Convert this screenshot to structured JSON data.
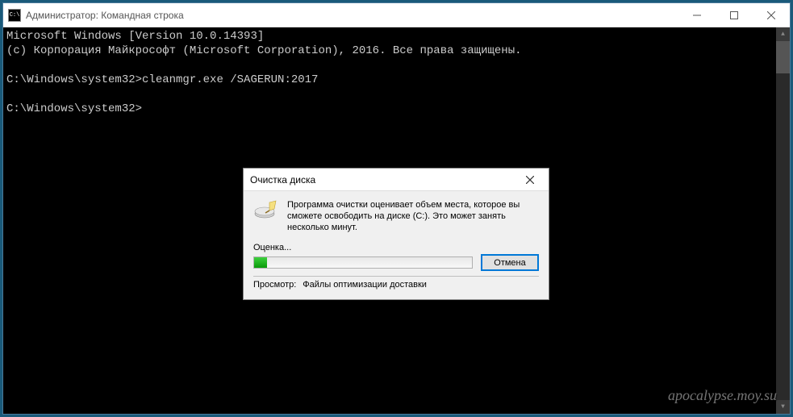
{
  "window": {
    "title": "Администратор: Командная строка"
  },
  "console": {
    "line1": "Microsoft Windows [Version 10.0.14393]",
    "line2": "(c) Корпорация Майкрософт (Microsoft Corporation), 2016. Все права защищены.",
    "line3": "",
    "line4": "C:\\Windows\\system32>cleanmgr.exe /SAGERUN:2017",
    "line5": "",
    "line6": "C:\\Windows\\system32>"
  },
  "dialog": {
    "title": "Очистка диска",
    "message": "Программа очистки оценивает объем места, которое вы сможете освободить на диске  (C:). Это может занять несколько минут.",
    "status": "Оценка...",
    "cancel": "Отмена",
    "footer_label": "Просмотр:",
    "footer_value": "Файлы оптимизации доставки"
  },
  "watermark": "apocalypse.moy.su"
}
